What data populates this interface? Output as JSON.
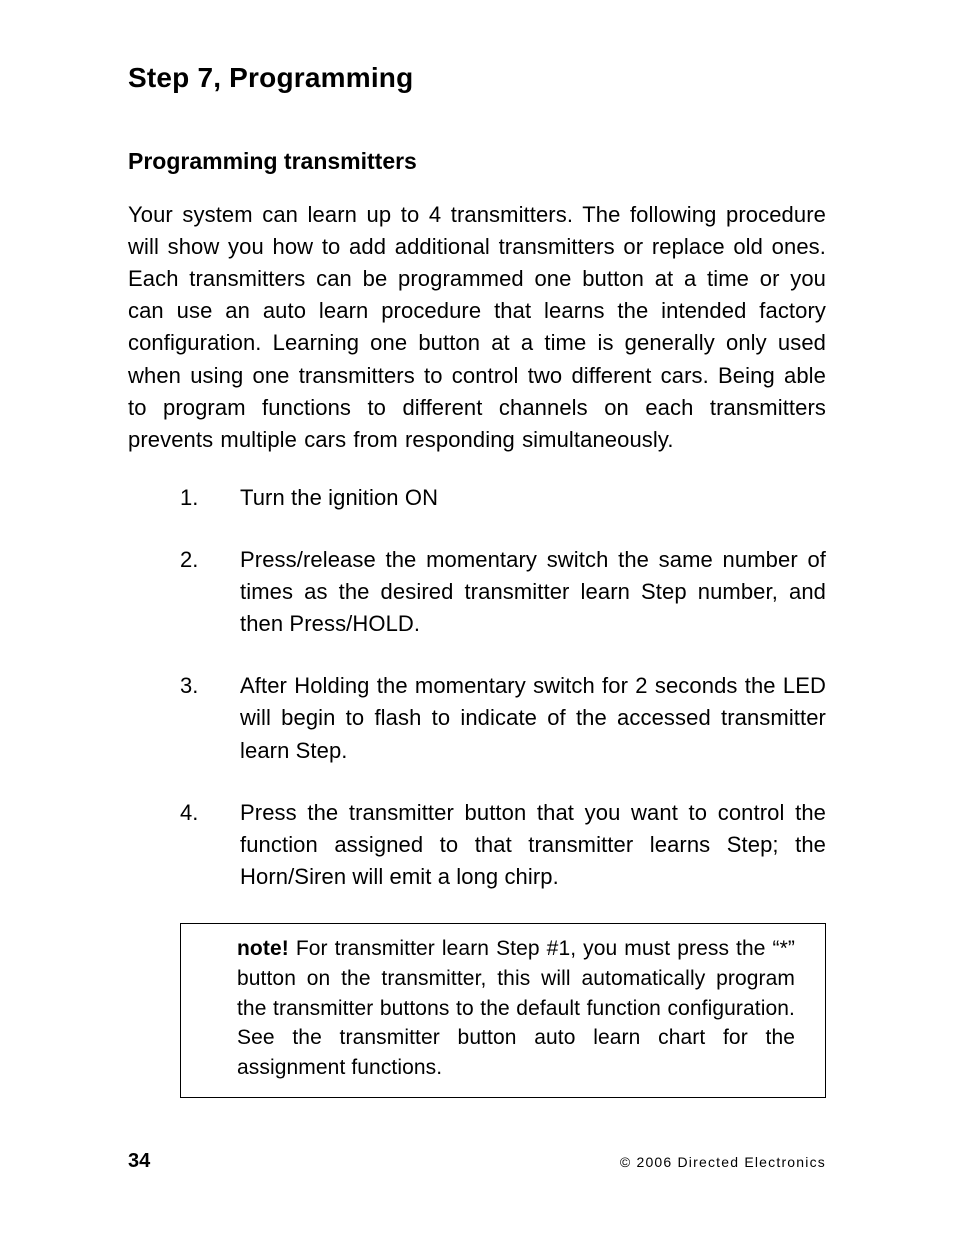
{
  "heading": "Step 7, Programming",
  "subheading": "Programming transmitters",
  "intro": "Your system can learn up to 4 transmitters.  The following procedure will show you how to add additional transmitters or replace old ones.  Each transmitters can be programmed one button at a time or you can use an auto learn procedure that learns the intended factory configuration.  Learning one button at a time is generally only used when using one transmitters to control two different cars.  Being able to program functions to different channels on each transmitters prevents multiple cars from responding simultaneously.",
  "steps": [
    {
      "num": "1.",
      "text": "Turn the ignition ON"
    },
    {
      "num": "2.",
      "text": "Press/release the momentary switch the same number of times as the desired transmitter learn Step number, and then Press/HOLD."
    },
    {
      "num": "3.",
      "text": "After Holding the momentary switch for 2 seconds the LED will begin to flash to indicate of the accessed transmitter learn Step."
    },
    {
      "num": "4.",
      "text": "Press the transmitter button that you want to control the function assigned to that transmitter learns Step; the Horn/Siren will emit a long chirp."
    }
  ],
  "note_label": "note!",
  "note_body": " For transmitter learn Step #1, you must press the “*” button on the transmitter, this will automatically program the transmitter buttons to the default function configuration.  See the transmitter button auto learn chart for the assignment functions.",
  "page_number": "34",
  "copyright": "© 2006 Directed Electronics"
}
